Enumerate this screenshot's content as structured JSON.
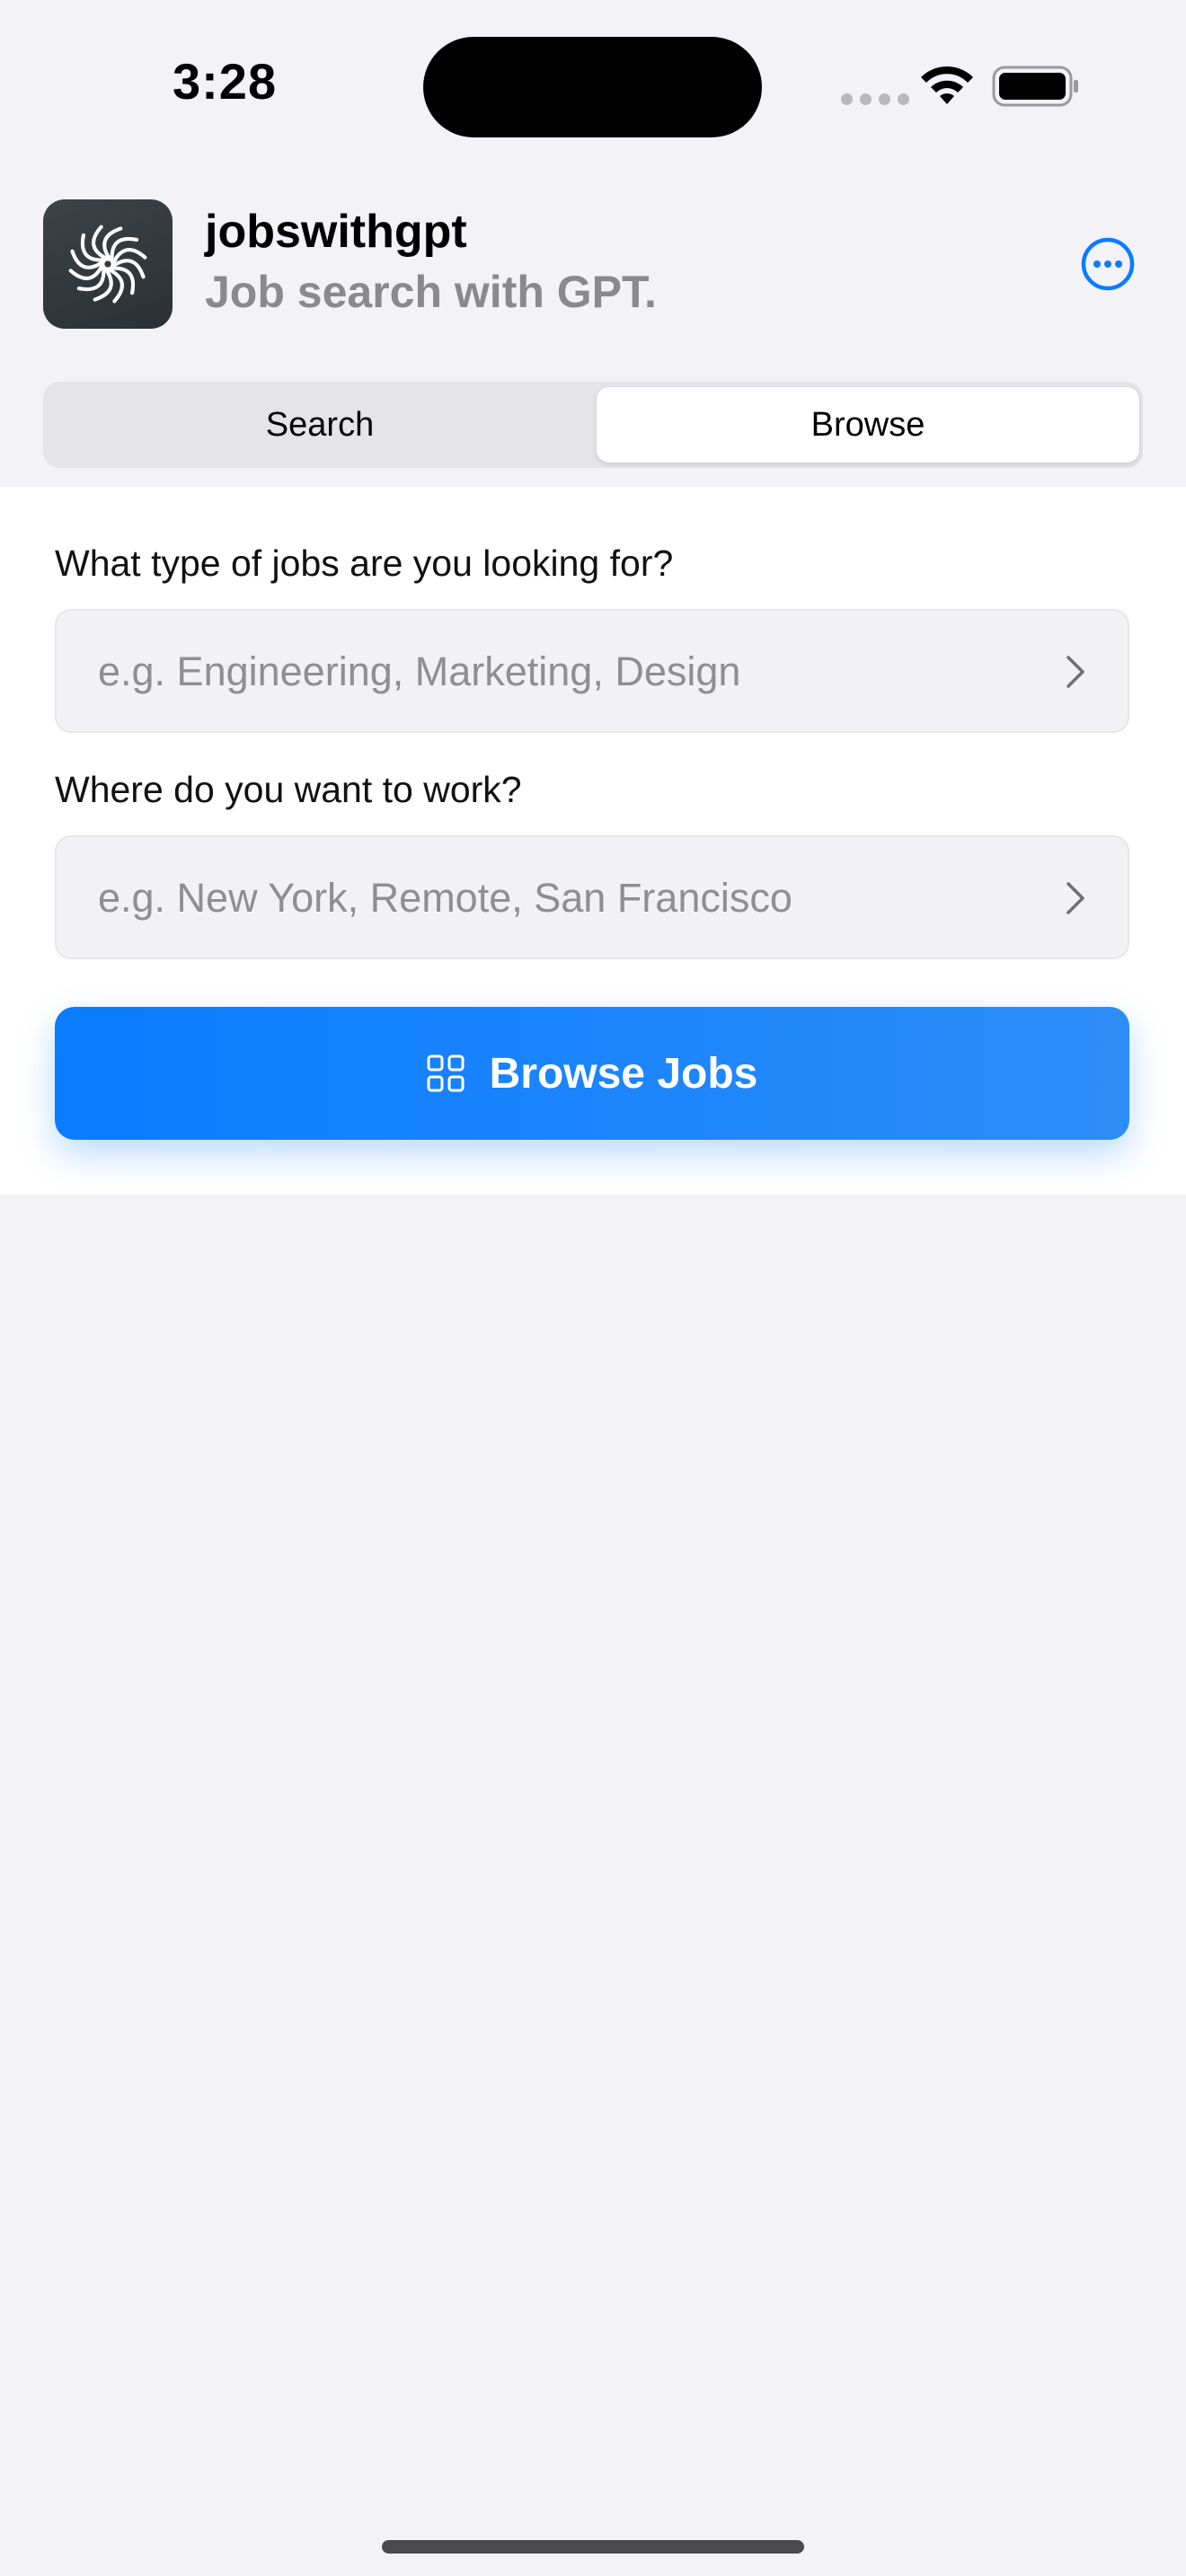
{
  "status_bar": {
    "time": "3:28"
  },
  "header": {
    "app_name": "jobswithgpt",
    "subtitle": "Job search with GPT.",
    "app_icon": "pinwheel-logo-icon",
    "menu_icon": "ellipsis-circle-icon"
  },
  "tabs": [
    {
      "label": "Search",
      "selected": false
    },
    {
      "label": "Browse",
      "selected": true
    }
  ],
  "form": {
    "job_type": {
      "label": "What type of jobs are you looking for?",
      "placeholder": "e.g. Engineering, Marketing, Design"
    },
    "location": {
      "label": "Where do you want to work?",
      "placeholder": "e.g. New York, Remote, San Francisco"
    },
    "submit": {
      "label": "Browse Jobs",
      "icon": "grid-icon"
    }
  },
  "colors": {
    "accent": "#0A7CFF",
    "background": "#F2F2F7",
    "placeholder": "#8E8E93"
  }
}
